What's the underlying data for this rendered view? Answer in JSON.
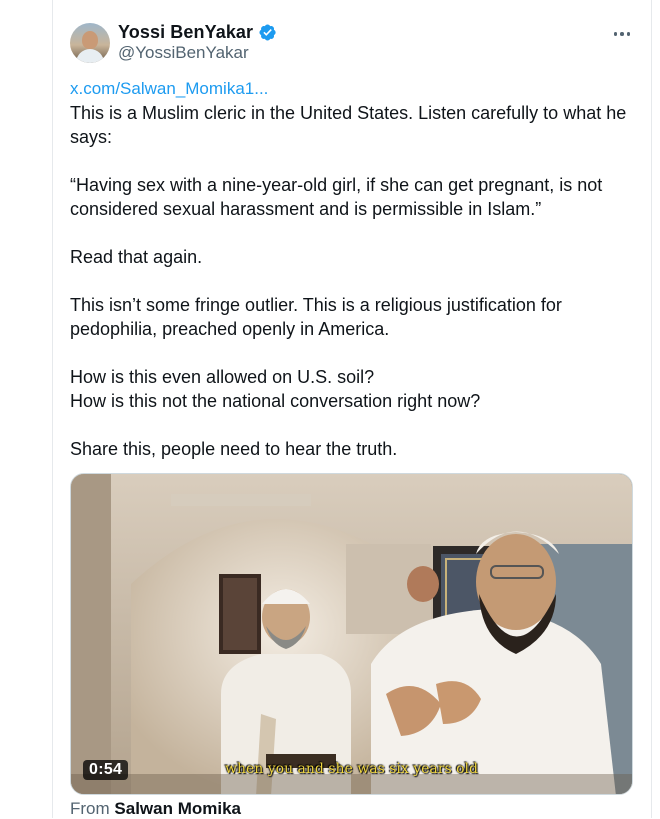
{
  "author": {
    "display_name": "Yossi BenYakar",
    "handle": "@YossiBenYakar",
    "verified_icon": "verified-badge-icon"
  },
  "tweet": {
    "link_text": "x.com/Salwan_Momika1...",
    "paragraphs": [
      "This is a Muslim cleric in the United States. Listen carefully to what he says:",
      "“Having sex with a nine-year-old girl, if she can get pregnant, is not considered sexual harassment and is permissible in Islam.”",
      "Read that again.",
      "This isn’t some fringe outlier. This is a religious justification for pedophilia, preached openly in America.",
      "How is this even allowed on U.S. soil?",
      "How is this not the national conversation right now?",
      "Share this, people need to hear the truth."
    ]
  },
  "media": {
    "duration": "0:54",
    "subtitle": "when you and she was six years old"
  },
  "attribution": {
    "prefix": "From",
    "source": "Salwan Momika"
  },
  "colors": {
    "link": "#1d9bf0",
    "verified": "#1d9bf0",
    "secondary_text": "#536471"
  }
}
